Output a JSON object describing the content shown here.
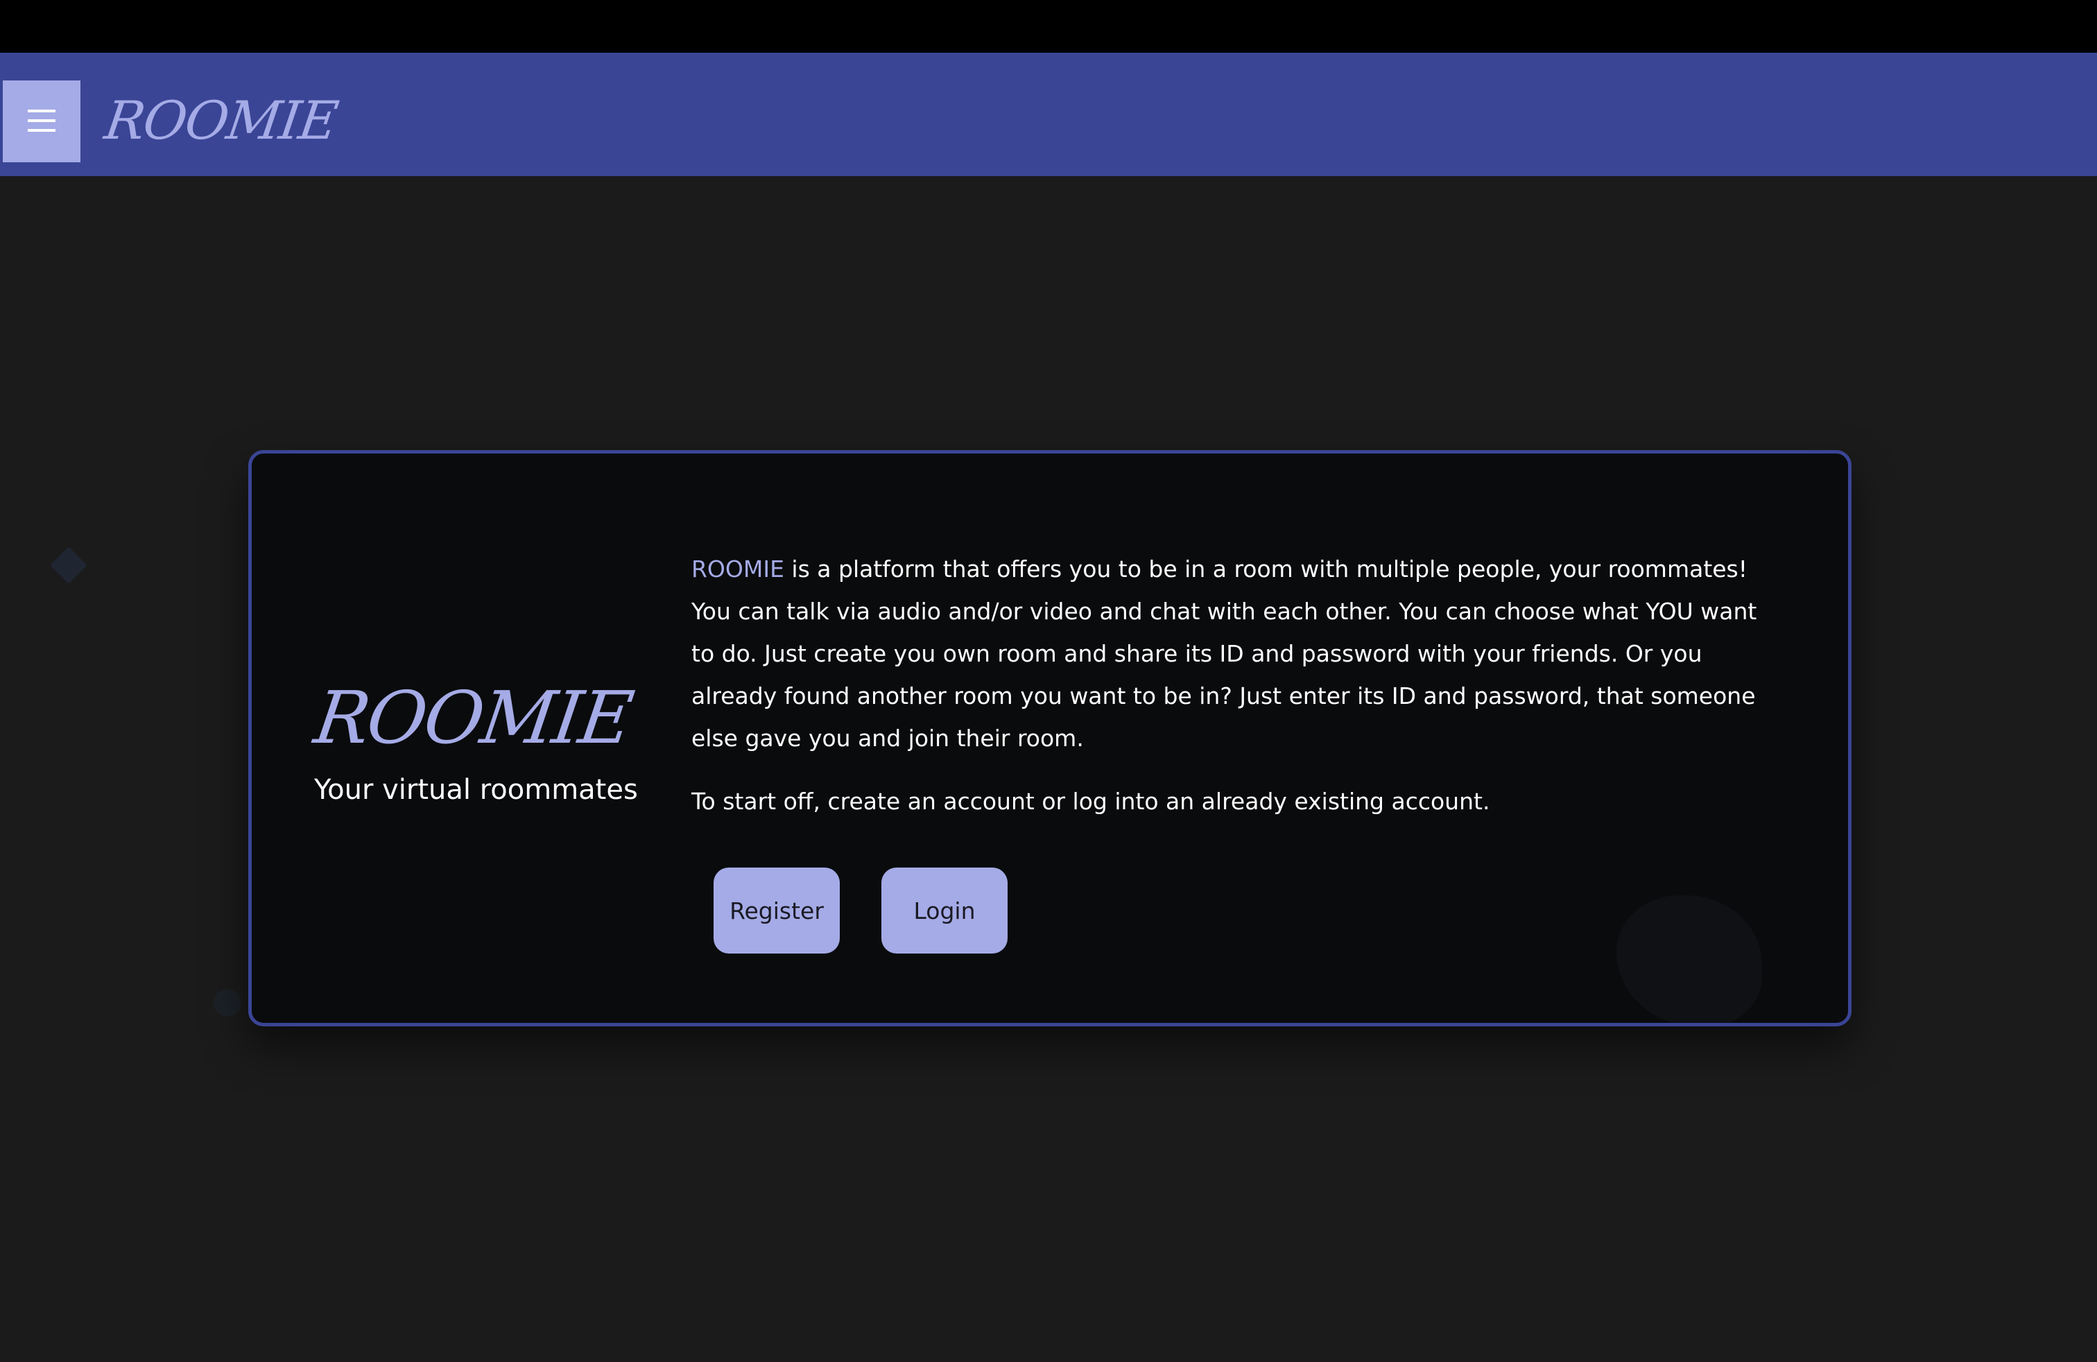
{
  "header": {
    "brand": "ROOMIE",
    "menu_icon": "hamburger-menu-icon"
  },
  "card": {
    "brand": "ROOMIE",
    "tagline": "Your virtual roommates",
    "intro_highlight": "ROOMIE",
    "intro_text": " is a platform that offers you to be in a room with multiple people, your roommates! You can talk via audio and/or video and chat with each other. You can choose what YOU want to do. Just create you own room and share its ID and password with your friends. Or you already found another room you want to be in? Just enter its ID and password, that someone else gave you and join their room.",
    "start_text": "To start off, create an account or log into an already existing account.",
    "register_label": "Register",
    "login_label": "Login"
  },
  "colors": {
    "navbar": "#3a4596",
    "accent": "#a5abe6",
    "background": "#1b1b1b",
    "card_background": "#0a0b0d"
  }
}
